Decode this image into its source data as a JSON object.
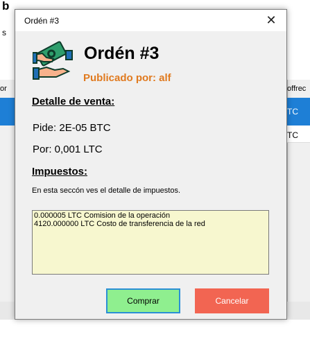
{
  "dialog": {
    "title": "Ordén #3",
    "close_glyph": "✕",
    "header": {
      "logo_icon": "money-hand-icon",
      "order_title": "Ordén #3",
      "published_by": "Publicado por: alf"
    },
    "sale_detail": {
      "heading": "Detalle de venta:",
      "asks": "Pide: 2E-05 BTC",
      "for": "Por: 0,001 LTC"
    },
    "taxes": {
      "heading": "Impuestos:",
      "description": "En esta seccón ves el detalle de impuestos.",
      "lines": [
        "0.000005 LTC Comision de la operación",
        "4120.000000 LTC Costo de transferencia de la red"
      ]
    },
    "buttons": {
      "buy": "Comprar",
      "cancel": "Cancelar"
    }
  },
  "background": {
    "left_fragments": [
      "b",
      "s",
      "or"
    ],
    "right_fragments": [
      "offrec",
      "TC",
      "TC"
    ]
  },
  "colors": {
    "publisher": "#e07a1f",
    "tax_box_bg": "#f7f7cf",
    "buy_bg": "#8fef8f",
    "cancel_bg": "#f26552",
    "selected_row": "#1e7fd6"
  }
}
